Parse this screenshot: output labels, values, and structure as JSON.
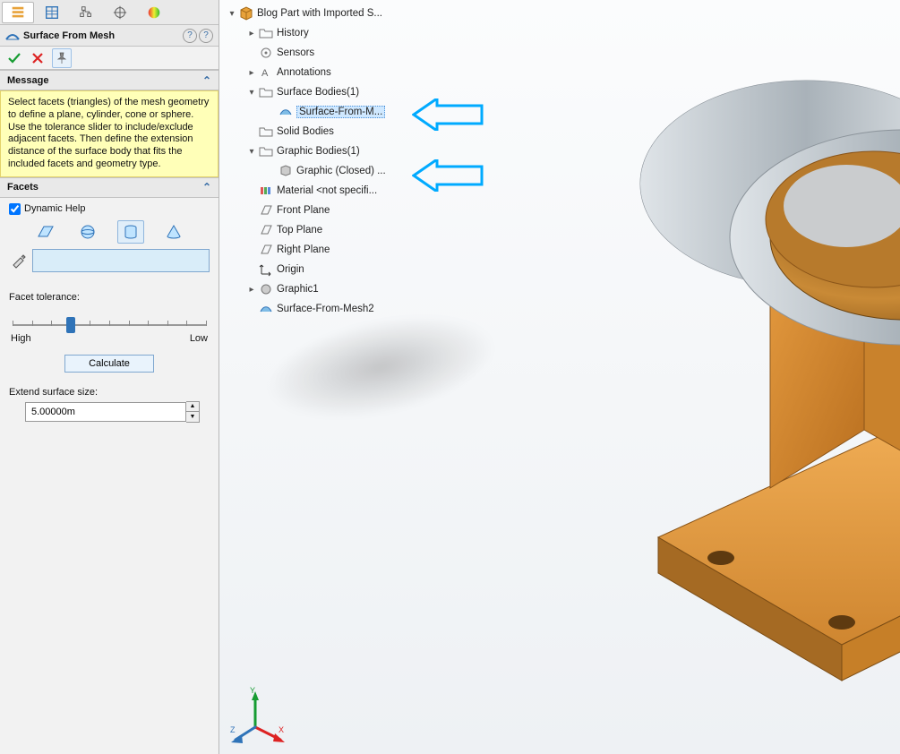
{
  "panel": {
    "title": "Surface From Mesh",
    "sections": {
      "message": {
        "header": "Message",
        "text": "Select facets (triangles) of the mesh geometry to define a plane, cylinder, cone or sphere.  Use the tolerance slider to include/exclude adjacent facets.  Then define the extension distance of the surface body that fits the included facets and geometry type."
      },
      "facets": {
        "header": "Facets",
        "dynamic_help_label": "Dynamic Help",
        "dynamic_help_checked": true
      },
      "tolerance": {
        "label": "Facet tolerance:",
        "low_label": "Low",
        "high_label": "High",
        "slider_percent": 30,
        "calc_label": "Calculate"
      },
      "extend": {
        "label": "Extend surface size:",
        "value": "5.00000m"
      }
    }
  },
  "tree": {
    "root": "Blog Part with Imported S...",
    "items": [
      "History",
      "Sensors",
      "Annotations",
      "Surface Bodies(1)",
      "Surface-From-M...",
      "Solid Bodies",
      "Graphic Bodies(1)",
      "Graphic (Closed) ...",
      "Material <not specifi...",
      "Front Plane",
      "Top Plane",
      "Right Plane",
      "Origin",
      "Graphic1",
      "Surface-From-Mesh2"
    ]
  },
  "triad": {
    "x": "X",
    "y": "Y",
    "z": "Z"
  }
}
